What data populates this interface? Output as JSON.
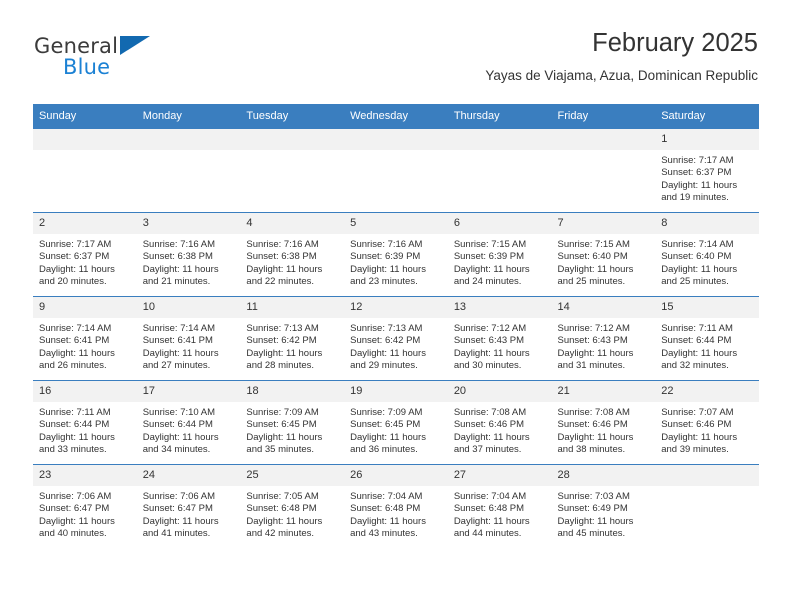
{
  "brand": {
    "name_top": "General",
    "name_bottom": "Blue",
    "triangle_color": "#1269b0",
    "blue_color": "#1b81d4",
    "gray_color": "#3b3b3b"
  },
  "header": {
    "title": "February 2025",
    "subtitle": "Yayas de Viajama, Azua, Dominican Republic"
  },
  "theme": {
    "header_bg": "#3a7ebf",
    "daynum_bg": "#f2f2f2",
    "text": "#333333",
    "border": "#3a7ebf"
  },
  "calendar": {
    "weekday_headers": [
      "Sunday",
      "Monday",
      "Tuesday",
      "Wednesday",
      "Thursday",
      "Friday",
      "Saturday"
    ],
    "labels": {
      "sunrise": "Sunrise:",
      "sunset": "Sunset:",
      "daylight": "Daylight:"
    },
    "weeks": [
      [
        {
          "day": "",
          "empty": true
        },
        {
          "day": "",
          "empty": true
        },
        {
          "day": "",
          "empty": true
        },
        {
          "day": "",
          "empty": true
        },
        {
          "day": "",
          "empty": true
        },
        {
          "day": "",
          "empty": true
        },
        {
          "day": "1",
          "sunrise": "Sunrise: 7:17 AM",
          "sunset": "Sunset: 6:37 PM",
          "daylight": "Daylight: 11 hours and 19 minutes."
        }
      ],
      [
        {
          "day": "2",
          "sunrise": "Sunrise: 7:17 AM",
          "sunset": "Sunset: 6:37 PM",
          "daylight": "Daylight: 11 hours and 20 minutes."
        },
        {
          "day": "3",
          "sunrise": "Sunrise: 7:16 AM",
          "sunset": "Sunset: 6:38 PM",
          "daylight": "Daylight: 11 hours and 21 minutes."
        },
        {
          "day": "4",
          "sunrise": "Sunrise: 7:16 AM",
          "sunset": "Sunset: 6:38 PM",
          "daylight": "Daylight: 11 hours and 22 minutes."
        },
        {
          "day": "5",
          "sunrise": "Sunrise: 7:16 AM",
          "sunset": "Sunset: 6:39 PM",
          "daylight": "Daylight: 11 hours and 23 minutes."
        },
        {
          "day": "6",
          "sunrise": "Sunrise: 7:15 AM",
          "sunset": "Sunset: 6:39 PM",
          "daylight": "Daylight: 11 hours and 24 minutes."
        },
        {
          "day": "7",
          "sunrise": "Sunrise: 7:15 AM",
          "sunset": "Sunset: 6:40 PM",
          "daylight": "Daylight: 11 hours and 25 minutes."
        },
        {
          "day": "8",
          "sunrise": "Sunrise: 7:14 AM",
          "sunset": "Sunset: 6:40 PM",
          "daylight": "Daylight: 11 hours and 25 minutes."
        }
      ],
      [
        {
          "day": "9",
          "sunrise": "Sunrise: 7:14 AM",
          "sunset": "Sunset: 6:41 PM",
          "daylight": "Daylight: 11 hours and 26 minutes."
        },
        {
          "day": "10",
          "sunrise": "Sunrise: 7:14 AM",
          "sunset": "Sunset: 6:41 PM",
          "daylight": "Daylight: 11 hours and 27 minutes."
        },
        {
          "day": "11",
          "sunrise": "Sunrise: 7:13 AM",
          "sunset": "Sunset: 6:42 PM",
          "daylight": "Daylight: 11 hours and 28 minutes."
        },
        {
          "day": "12",
          "sunrise": "Sunrise: 7:13 AM",
          "sunset": "Sunset: 6:42 PM",
          "daylight": "Daylight: 11 hours and 29 minutes."
        },
        {
          "day": "13",
          "sunrise": "Sunrise: 7:12 AM",
          "sunset": "Sunset: 6:43 PM",
          "daylight": "Daylight: 11 hours and 30 minutes."
        },
        {
          "day": "14",
          "sunrise": "Sunrise: 7:12 AM",
          "sunset": "Sunset: 6:43 PM",
          "daylight": "Daylight: 11 hours and 31 minutes."
        },
        {
          "day": "15",
          "sunrise": "Sunrise: 7:11 AM",
          "sunset": "Sunset: 6:44 PM",
          "daylight": "Daylight: 11 hours and 32 minutes."
        }
      ],
      [
        {
          "day": "16",
          "sunrise": "Sunrise: 7:11 AM",
          "sunset": "Sunset: 6:44 PM",
          "daylight": "Daylight: 11 hours and 33 minutes."
        },
        {
          "day": "17",
          "sunrise": "Sunrise: 7:10 AM",
          "sunset": "Sunset: 6:44 PM",
          "daylight": "Daylight: 11 hours and 34 minutes."
        },
        {
          "day": "18",
          "sunrise": "Sunrise: 7:09 AM",
          "sunset": "Sunset: 6:45 PM",
          "daylight": "Daylight: 11 hours and 35 minutes."
        },
        {
          "day": "19",
          "sunrise": "Sunrise: 7:09 AM",
          "sunset": "Sunset: 6:45 PM",
          "daylight": "Daylight: 11 hours and 36 minutes."
        },
        {
          "day": "20",
          "sunrise": "Sunrise: 7:08 AM",
          "sunset": "Sunset: 6:46 PM",
          "daylight": "Daylight: 11 hours and 37 minutes."
        },
        {
          "day": "21",
          "sunrise": "Sunrise: 7:08 AM",
          "sunset": "Sunset: 6:46 PM",
          "daylight": "Daylight: 11 hours and 38 minutes."
        },
        {
          "day": "22",
          "sunrise": "Sunrise: 7:07 AM",
          "sunset": "Sunset: 6:46 PM",
          "daylight": "Daylight: 11 hours and 39 minutes."
        }
      ],
      [
        {
          "day": "23",
          "sunrise": "Sunrise: 7:06 AM",
          "sunset": "Sunset: 6:47 PM",
          "daylight": "Daylight: 11 hours and 40 minutes."
        },
        {
          "day": "24",
          "sunrise": "Sunrise: 7:06 AM",
          "sunset": "Sunset: 6:47 PM",
          "daylight": "Daylight: 11 hours and 41 minutes."
        },
        {
          "day": "25",
          "sunrise": "Sunrise: 7:05 AM",
          "sunset": "Sunset: 6:48 PM",
          "daylight": "Daylight: 11 hours and 42 minutes."
        },
        {
          "day": "26",
          "sunrise": "Sunrise: 7:04 AM",
          "sunset": "Sunset: 6:48 PM",
          "daylight": "Daylight: 11 hours and 43 minutes."
        },
        {
          "day": "27",
          "sunrise": "Sunrise: 7:04 AM",
          "sunset": "Sunset: 6:48 PM",
          "daylight": "Daylight: 11 hours and 44 minutes."
        },
        {
          "day": "28",
          "sunrise": "Sunrise: 7:03 AM",
          "sunset": "Sunset: 6:49 PM",
          "daylight": "Daylight: 11 hours and 45 minutes."
        },
        {
          "day": "",
          "empty": true
        }
      ]
    ]
  }
}
